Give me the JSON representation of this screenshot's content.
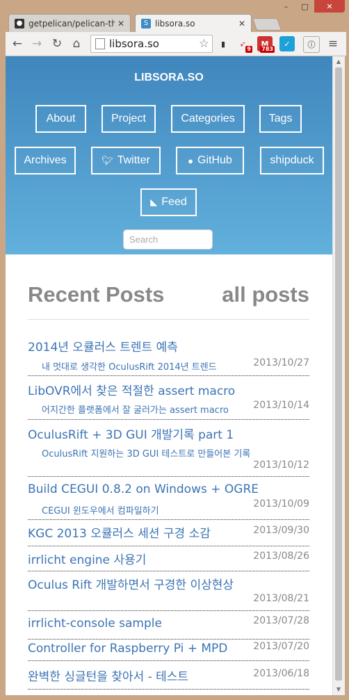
{
  "browser": {
    "tabs": [
      {
        "title": "getpelican/pelican-the",
        "active": false,
        "favicon": "github-icon"
      },
      {
        "title": "libsora.so",
        "active": true,
        "favicon": "site-favicon"
      }
    ],
    "url": "libsora.so",
    "window_controls": {
      "minimize": "–",
      "maximize": "□",
      "close": "✕"
    },
    "extensions": [
      {
        "name": "ext-plug-icon"
      },
      {
        "name": "ext-bird-icon",
        "badge": "9"
      },
      {
        "name": "gmail-checker-icon",
        "badge": "783"
      },
      {
        "name": "ext-check-icon"
      },
      {
        "name": "ext-shield-icon"
      }
    ]
  },
  "site": {
    "title": "LIBSORA.SO",
    "menu": {
      "about": "About",
      "project": "Project",
      "categories": "Categories",
      "tags": "Tags",
      "archives": "Archives",
      "twitter": "Twitter",
      "github": "GitHub",
      "shipduck": "shipduck",
      "feed": "Feed"
    },
    "search_placeholder": "Search"
  },
  "content": {
    "recent_title": "Recent Posts",
    "all_posts": "all posts",
    "posts": [
      {
        "title": "2014년 오큘러스 트렌트 예측",
        "subtitle": "내 멋대로 생각한 OculusRift 2014년 트렌드",
        "date": "2013/10/27"
      },
      {
        "title": "LibOVR에서 찾은 적절한 assert macro",
        "subtitle": "어지간한 플랫폼에서 잘 굴러가는 assert macro",
        "date": "2013/10/14"
      },
      {
        "title": "OculusRift + 3D GUI 개발기록 part 1",
        "subtitle": "OculusRift 지원하는 3D GUI 테스트로 만들어본 기록",
        "date": "2013/10/12"
      },
      {
        "title": "Build CEGUI 0.8.2 on Windows + OGRE",
        "subtitle": "CEGUI 윈도우에서 컴파일하기",
        "date": "2013/10/09"
      },
      {
        "title": "KGC 2013 오큘러스 세션 구경 소감",
        "subtitle": "",
        "date": "2013/09/30"
      },
      {
        "title": "irrlicht engine 사용기",
        "subtitle": "",
        "date": "2013/08/26"
      },
      {
        "title": "Oculus Rift 개발하면서 구경한 이상현상",
        "subtitle": "",
        "date": "2013/08/21"
      },
      {
        "title": "irrlicht-console sample",
        "subtitle": "",
        "date": "2013/07/28"
      },
      {
        "title": "Controller for Raspberry Pi + MPD",
        "subtitle": "",
        "date": "2013/07/20"
      },
      {
        "title": "완벽한 싱글턴을 찾아서 - 테스트",
        "subtitle": "",
        "date": "2013/06/18"
      }
    ]
  }
}
